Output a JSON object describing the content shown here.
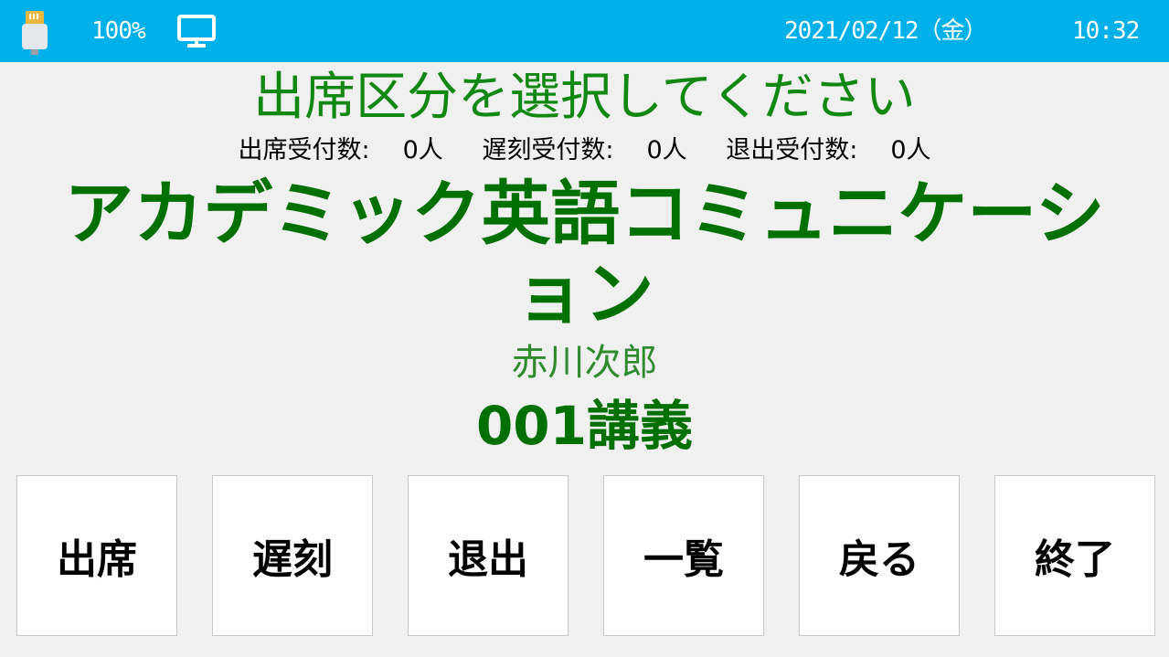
{
  "statusbar": {
    "battery": "100%",
    "date": "2021/02/12（金）",
    "time": "10:32",
    "background": "#00b0e8"
  },
  "instruction": "出席区分を選択してください",
  "counts": {
    "attendance_label": "出席受付数:",
    "attendance_value": "0人",
    "late_label": "遅刻受付数:",
    "late_value": "0人",
    "leave_label": "退出受付数:",
    "leave_value": "0人"
  },
  "course": {
    "title": "アカデミック英語コミュニケーション",
    "teacher": "赤川次郎",
    "lecture": "001講義"
  },
  "buttons": {
    "attend": "出席",
    "late": "遅刻",
    "leave": "退出",
    "list": "一覧",
    "back": "戻る",
    "finish": "終了"
  },
  "icons": [
    "usb-card-reader-icon",
    "monitor-icon"
  ],
  "colors": {
    "accent": "#00b0e8",
    "title_green": "#007000",
    "light_green": "#2e8b2e"
  }
}
